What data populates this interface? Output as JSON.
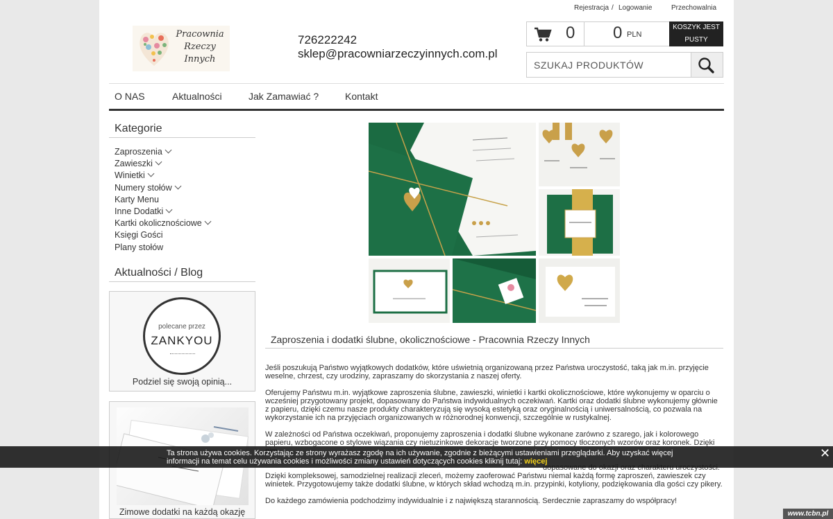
{
  "top_links": {
    "register": "Rejestracja",
    "separator": "/",
    "login": "Logowanie",
    "storage": "Przechowalnia"
  },
  "logo": {
    "line1": "Pracownia",
    "line2": "Rzeczy",
    "line3": "Innych"
  },
  "contact": {
    "phone": "726222242",
    "email": "sklep@pracowniarzeczyinnych.com.pl"
  },
  "cart": {
    "icon": "cart-icon",
    "item_count": "0",
    "total": "0",
    "currency": "PLN",
    "status_line1": "KOSZYK JEST",
    "status_line2": "PUSTY"
  },
  "search": {
    "placeholder": "SZUKAJ PRODUKTÓW",
    "icon": "search-icon"
  },
  "nav": {
    "items": [
      "O NAS",
      "Aktualności",
      "Jak Zamawiać ?",
      "Kontakt"
    ]
  },
  "sidebar": {
    "categories_heading": "Kategorie",
    "categories": [
      {
        "label": "Zaproszenia",
        "expandable": true
      },
      {
        "label": "Zawieszki",
        "expandable": true
      },
      {
        "label": "Winietki",
        "expandable": true
      },
      {
        "label": "Numery stołów",
        "expandable": true
      },
      {
        "label": "Karty Menu",
        "expandable": false
      },
      {
        "label": "Inne Dodatki",
        "expandable": true
      },
      {
        "label": "Kartki okolicznościowe",
        "expandable": true
      },
      {
        "label": "Księgi Gości",
        "expandable": false
      },
      {
        "label": "Plany stołów",
        "expandable": false
      }
    ],
    "blog_heading": "Aktualności / Blog",
    "zankyou": {
      "small": "polecane przez",
      "brand": "ZANKYOU",
      "caption": "Podziel się swoją opinią..."
    },
    "blog_post": {
      "caption": "Zimowe dodatki na każdą okazję"
    }
  },
  "main": {
    "title": "Zaproszenia i dodatki ślubne, okolicznościowe - Pracownia Rzeczy Innych",
    "paragraphs": [
      "Jeśli poszukują Państwo wyjątkowych dodatków, które uświetnią organizowaną przez Państwa uroczystość, taką jak m.in. przyjęcie weselne, chrzest, czy urodziny, zapraszamy do skorzystania z naszej oferty.",
      "Oferujemy Państwu m.in. wyjątkowe zaproszenia ślubne, zawieszki, winietki i kartki okolicznościowe, które wykonujemy w oparciu o wcześniej przygotowany projekt, dopasowany do Państwa indywidualnych oczekiwań. Kartki oraz dodatki ślubne wykonujemy głównie z papieru, dzięki czemu nasze produkty charakteryzują się wysoką estetyką oraz oryginalnością i uniwersalnością, co pozwala na wykorzystanie ich na przyjęciach organizowanych w różnorodnej konwencji, szczególnie w rustykalnej.",
      "W zależności od Państwa oczekiwań, proponujemy zaproszenia i dodatki ślubne wykonane zarówno z szarego, jak i kolorowego papieru, wzbogacone o stylowe wiązania czy nietuzinkowe dekoracje tworzone przy pomocy tłoczonych wzorów oraz koronek. Dzięki nim,",
      "dopasowane do okazji oraz charakteru uroczystości.",
      "Dzięki kompleksowej, samodzielnej realizacji zleceń, możemy zaoferować Państwu niemal każdą formę zaproszeń, zawieszek czy winietek. Przygotowujemy także dodatki ślubne, w których skład wchodzą m.in. przypinki, kotyliony, podziękowania dla gości czy pikery.",
      "Do każdego zamówienia podchodzimy indywidualnie i z największą starannością. Serdecznie zapraszamy do współpracy!"
    ]
  },
  "cookie_bar": {
    "text": "Ta strona używa cookies. Korzystając ze strony wyrażasz zgodę na ich używanie, zgodnie z bieżącymi ustawieniami przeglądarki. Aby uzyskać więcej informacji na temat celu używania cookies i możliwości zmiany ustawień dotyczących cookies kliknij tutaj:",
    "more_link": "więcej",
    "close_icon": "close-icon"
  },
  "watermark": "www.tcbn.pl"
}
